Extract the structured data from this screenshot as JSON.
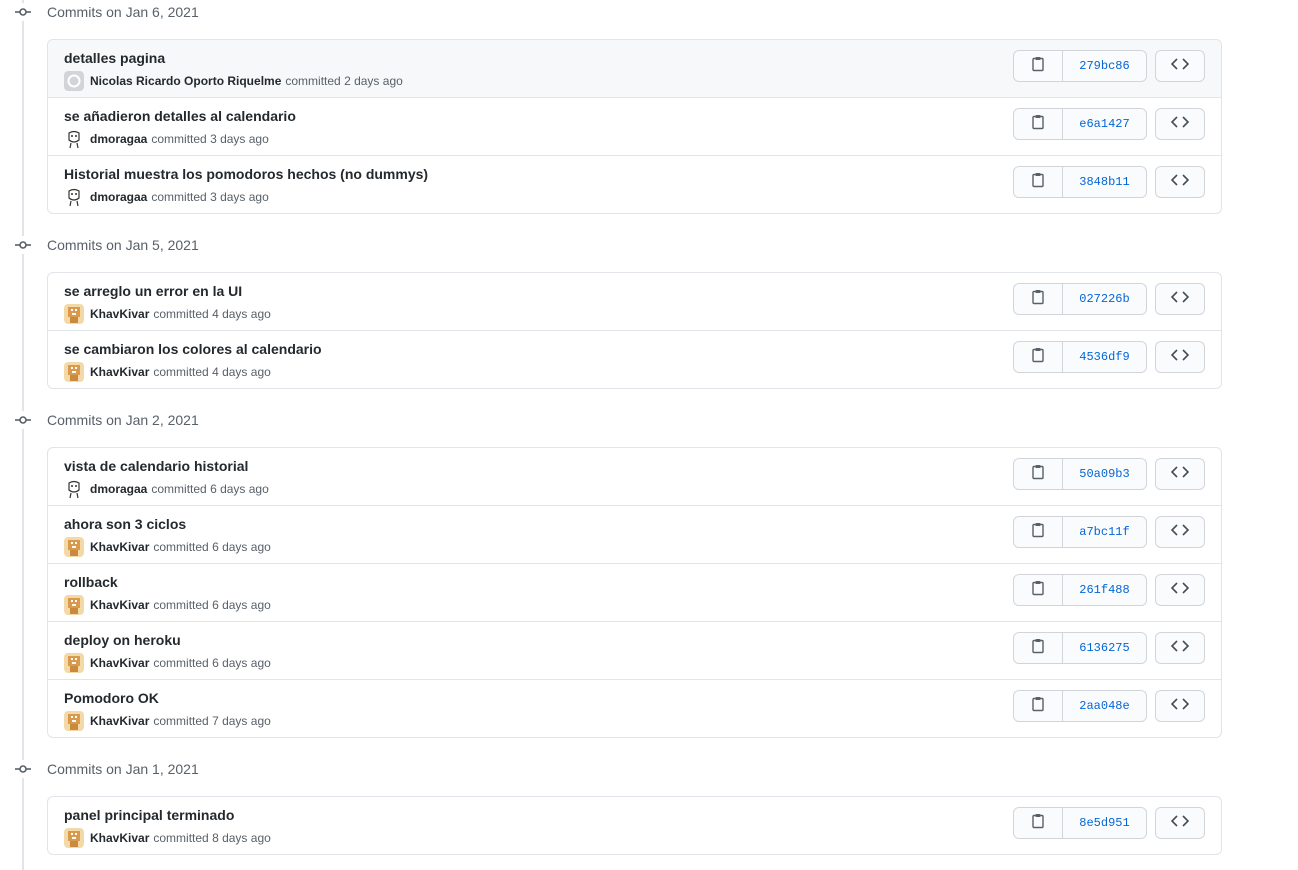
{
  "colors": {
    "link": "#0366d6",
    "muted": "#586069",
    "border": "#e1e4e8",
    "highlight_row": "#f6f8fa"
  },
  "groups": [
    {
      "title": "Commits on Jan 6, 2021",
      "commits": [
        {
          "message": "detalles pagina",
          "author": "Nicolas Ricardo Oporto Riquelme",
          "action": "committed",
          "time": "2 days ago",
          "sha": "279bc86",
          "avatar": "github-default-avatar"
        },
        {
          "message": "se añadieron detalles al calendario",
          "author": "dmoragaa",
          "action": "committed",
          "time": "3 days ago",
          "sha": "e6a1427",
          "avatar": "sketch-avatar"
        },
        {
          "message": "Historial muestra los pomodoros hechos (no dummys)",
          "author": "dmoragaa",
          "action": "committed",
          "time": "3 days ago",
          "sha": "3848b11",
          "avatar": "sketch-avatar"
        }
      ]
    },
    {
      "title": "Commits on Jan 5, 2021",
      "commits": [
        {
          "message": "se arreglo un error en la UI",
          "author": "KhavKivar",
          "action": "committed",
          "time": "4 days ago",
          "sha": "027226b",
          "avatar": "pixel-avatar"
        },
        {
          "message": "se cambiaron los colores al calendario",
          "author": "KhavKivar",
          "action": "committed",
          "time": "4 days ago",
          "sha": "4536df9",
          "avatar": "pixel-avatar"
        }
      ]
    },
    {
      "title": "Commits on Jan 2, 2021",
      "commits": [
        {
          "message": "vista de calendario historial",
          "author": "dmoragaa",
          "action": "committed",
          "time": "6 days ago",
          "sha": "50a09b3",
          "avatar": "sketch-avatar"
        },
        {
          "message": "ahora son 3 ciclos",
          "author": "KhavKivar",
          "action": "committed",
          "time": "6 days ago",
          "sha": "a7bc11f",
          "avatar": "pixel-avatar"
        },
        {
          "message": "rollback",
          "author": "KhavKivar",
          "action": "committed",
          "time": "6 days ago",
          "sha": "261f488",
          "avatar": "pixel-avatar"
        },
        {
          "message": "deploy on heroku",
          "author": "KhavKivar",
          "action": "committed",
          "time": "6 days ago",
          "sha": "6136275",
          "avatar": "pixel-avatar"
        },
        {
          "message": "Pomodoro OK",
          "author": "KhavKivar",
          "action": "committed",
          "time": "7 days ago",
          "sha": "2aa048e",
          "avatar": "pixel-avatar"
        }
      ]
    },
    {
      "title": "Commits on Jan 1, 2021",
      "commits": [
        {
          "message": "panel principal terminado",
          "author": "KhavKivar",
          "action": "committed",
          "time": "8 days ago",
          "sha": "8e5d951",
          "avatar": "pixel-avatar"
        }
      ]
    }
  ],
  "icons": {
    "commit": "git-commit-icon",
    "copy": "clipboard-icon",
    "browse": "code-icon"
  }
}
